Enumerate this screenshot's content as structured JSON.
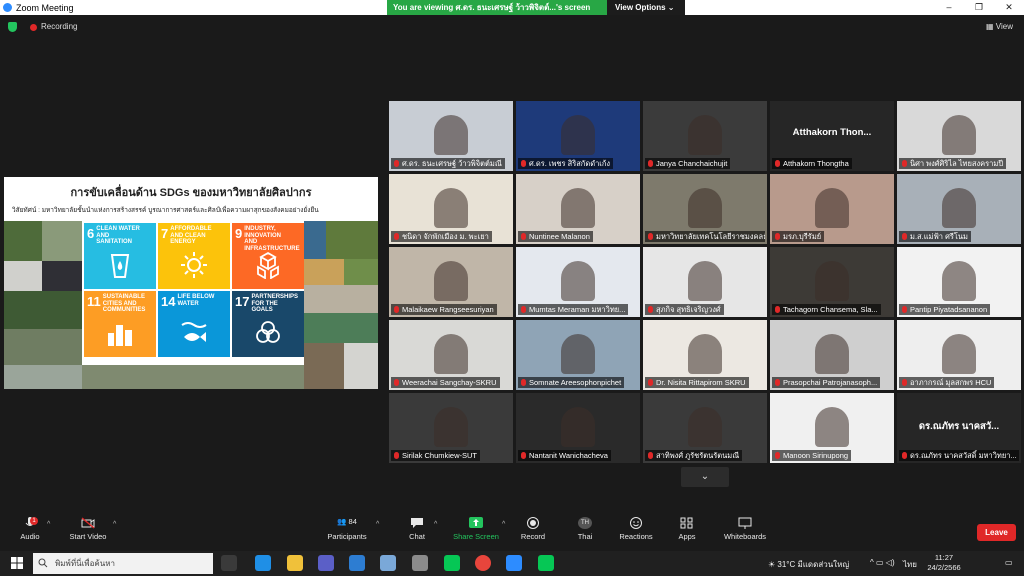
{
  "window": {
    "title": "Zoom Meeting",
    "minimize": "–",
    "maximize": "❐",
    "close": "✕"
  },
  "viewing_banner": {
    "message": "You are viewing ศ.ดร. ธนะเศรษฐ์ ว้าวพิจิตต์...'s screen",
    "options_label": "View Options ⌄"
  },
  "status": {
    "recording_label": "Recording",
    "view_label": "View"
  },
  "shared_screen": {
    "title": "การขับเคลื่อนด้าน SDGs ของมหาวิทยาลัยศิลปากร",
    "vision": "วิสัยทัศน์ : มหาวิทยาลัยชั้นนำแห่งการสร้างสรรค์ บูรณาการศาสตร์และศิลป์เพื่อความผาสุกของสังคมอย่างยั่งยืน",
    "sdgs": [
      {
        "num": "6",
        "label": "CLEAN WATER AND SANITATION",
        "color": "#26bde2"
      },
      {
        "num": "7",
        "label": "AFFORDABLE AND CLEAN ENERGY",
        "color": "#fcc30b"
      },
      {
        "num": "9",
        "label": "INDUSTRY, INNOVATION AND INFRASTRUCTURE",
        "color": "#fd6925"
      },
      {
        "num": "11",
        "label": "SUSTAINABLE CITIES AND COMMUNITIES",
        "color": "#fd9d24"
      },
      {
        "num": "14",
        "label": "LIFE BELOW WATER",
        "color": "#0a97d9"
      },
      {
        "num": "17",
        "label": "PARTNERSHIPS FOR THE GOALS",
        "color": "#19486a"
      }
    ]
  },
  "participants": [
    {
      "name": "ศ.ดร. ธนะเศรษฐ์ ว้าวพิจิตต์มณี",
      "active": true
    },
    {
      "name": "ศ.ดร. เพชร สิริสกัดดำเก้ง"
    },
    {
      "name": "Janya Chanchaichujit"
    },
    {
      "name": "Atthakorn Thongtha",
      "big_name": "Atthakorn Thon..."
    },
    {
      "name": "นิศา พงศ์ศิริไล ไทยสงครามปี"
    },
    {
      "name": "ชนิดา จักพักเมือง ม. พะเยา"
    },
    {
      "name": "Nuntinee Malanon"
    },
    {
      "name": "มหาวิทยาลัยเทคโนโลยีราชมงคลธัญบุรี"
    },
    {
      "name": "มรภ.บุรีรัมย์"
    },
    {
      "name": "ม.ส.แม่ฟ้า ศรีโนม"
    },
    {
      "name": "Malaikaew Rangseesuriyan"
    },
    {
      "name": "Mumtas Meraman มหาวิทย..."
    },
    {
      "name": "สุภกิจ สุทธิเจริญวงศ์"
    },
    {
      "name": "Tachagorn Chansema, Sla..."
    },
    {
      "name": "Pantip Piyatadsananon"
    },
    {
      "name": "Weerachai Sangchay-SKRU"
    },
    {
      "name": "Somnate Areesophonpichet"
    },
    {
      "name": "Dr. Nisita Rittapirom SKRU"
    },
    {
      "name": "Prasopchai Patrojanasoph..."
    },
    {
      "name": "อาภากรณ์ มุลสกพร HCU"
    },
    {
      "name": "Sirilak Chumkiew-SUT"
    },
    {
      "name": "Nantanit Wanichacheva"
    },
    {
      "name": "สาทิพงศ์ ภูรัชรัตนรัตนมณี"
    },
    {
      "name": "Manoon Sirinupong"
    },
    {
      "name": "ดร.ณภัทร นาคสวัสดิ์ มหาวิทยา...",
      "big_name": "ดร.ณภัทร นาคสวั..."
    }
  ],
  "toolbar": {
    "audio": "Audio",
    "audio_badge": "1",
    "video": "Start Video",
    "participants": "Participants",
    "participants_count": "84",
    "chat": "Chat",
    "share": "Share Screen",
    "record": "Record",
    "thai": "Thai",
    "thai_initials": "TH",
    "reactions": "Reactions",
    "apps": "Apps",
    "whiteboards": "Whiteboards",
    "leave": "Leave"
  },
  "taskbar": {
    "search_placeholder": "พิมพ์ที่นี่เพื่อค้นหา",
    "weather": "31°C มีแดดส่วนใหญ่",
    "lang": "ไทย",
    "time": "11:27",
    "date": "24/2/2566"
  }
}
